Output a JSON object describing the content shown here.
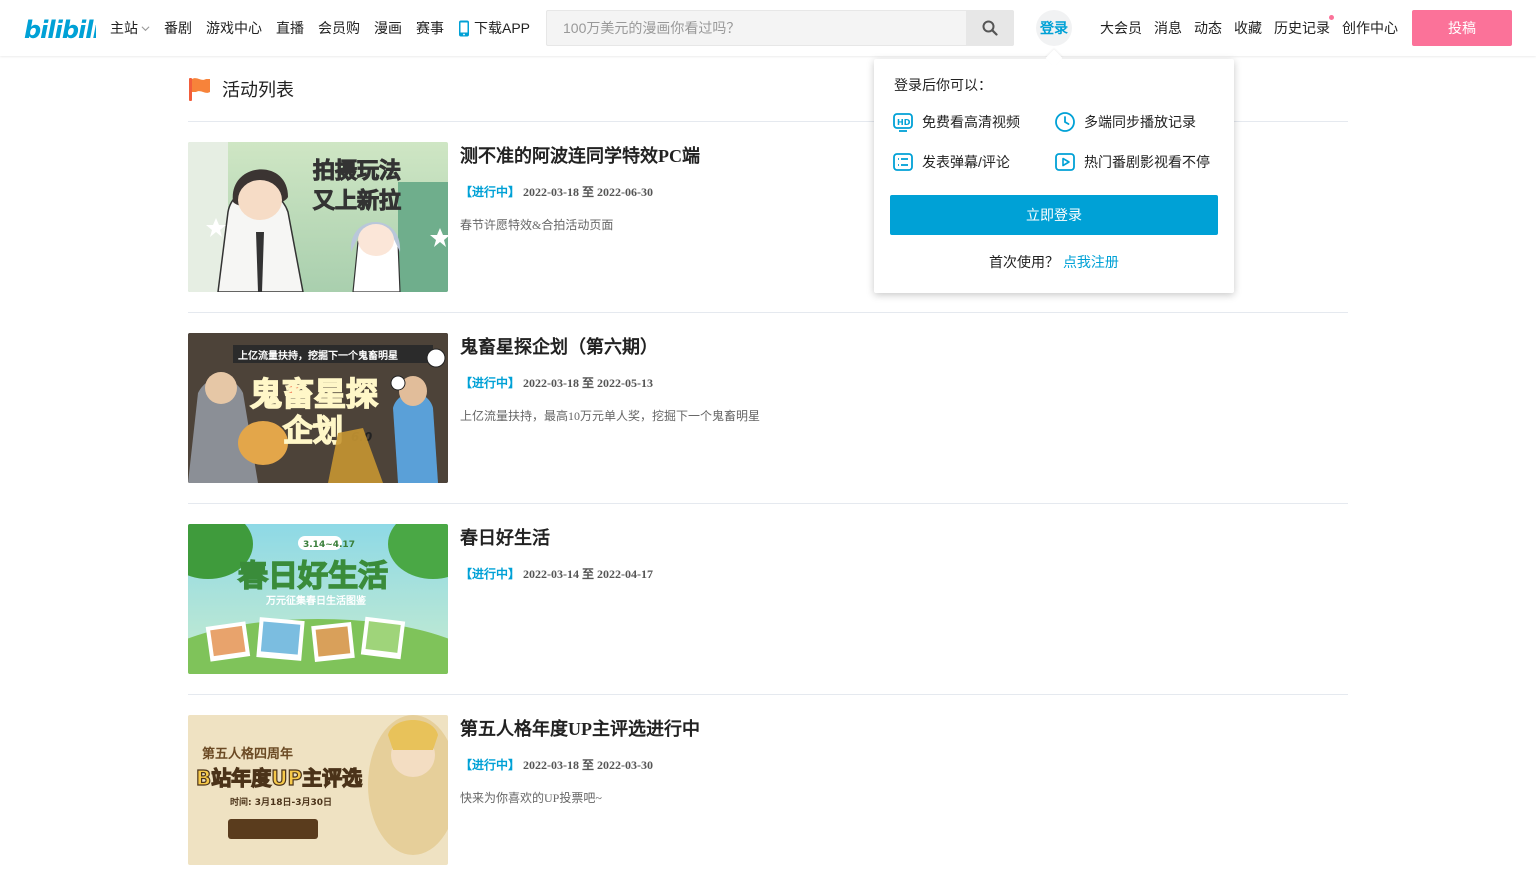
{
  "header": {
    "logo_text": "bilibili",
    "nav_left": [
      {
        "label": "主站",
        "has_dropdown": true
      },
      {
        "label": "番剧"
      },
      {
        "label": "游戏中心"
      },
      {
        "label": "直播"
      },
      {
        "label": "会员购"
      },
      {
        "label": "漫画"
      },
      {
        "label": "赛事"
      },
      {
        "label": "下载APP",
        "icon": "phone-icon"
      }
    ],
    "search": {
      "placeholder": "100万美元的漫画你看过吗？",
      "icon": "search-icon"
    },
    "login_label": "登录",
    "nav_right": [
      {
        "label": "大会员"
      },
      {
        "label": "消息"
      },
      {
        "label": "动态"
      },
      {
        "label": "收藏"
      },
      {
        "label": "历史记录",
        "has_dot": true
      },
      {
        "label": "创作中心"
      }
    ],
    "upload_label": "投稿",
    "colors": {
      "brand_blue": "#00a1d6",
      "brand_pink": "#fb7299"
    }
  },
  "main": {
    "title": "活动列表",
    "title_icon": "flag-icon",
    "activities": [
      {
        "title": "测不准的阿波连同学特效PC端",
        "status": "【进行中】",
        "start": "2022-03-18",
        "range_sep": "至",
        "end": "2022-06-30",
        "desc": "春节许愿特效&合拍活动页面",
        "thumb_text_1": "拍摄玩法",
        "thumb_text_2": "又上新拉"
      },
      {
        "title": "鬼畜星探企划（第六期）",
        "status": "【进行中】",
        "start": "2022-03-18",
        "range_sep": "至",
        "end": "2022-05-13",
        "desc": "上亿流量扶持，最高10万元单人奖，挖掘下一个鬼畜明星",
        "thumb_text_1": "上亿流量扶持，挖掘下一个鬼畜明星",
        "thumb_text_2": "鬼畜星探",
        "thumb_text_3": "企划",
        "thumb_text_4": "6.0"
      },
      {
        "title": "春日好生活",
        "status": "【进行中】",
        "start": "2022-03-14",
        "range_sep": "至",
        "end": "2022-04-17",
        "desc": "",
        "thumb_text_1": "3.14~4.17",
        "thumb_text_2": "春日好生活",
        "thumb_text_3": "万元征集春日生活图鉴"
      },
      {
        "title": "第五人格年度UP主评选进行中",
        "status": "【进行中】",
        "start": "2022-03-18",
        "range_sep": "至",
        "end": "2022-03-30",
        "desc": "快来为你喜欢的UP投票吧~",
        "thumb_text_1": "第五人格四周年",
        "thumb_text_2": "B站年度UP主评选",
        "thumb_text_3": "时间: 3月18日-3月30日"
      }
    ]
  },
  "login_popup": {
    "title": "登录后你可以：",
    "perks": [
      {
        "label": "免费看高清视频",
        "icon": "hd-icon"
      },
      {
        "label": "多端同步播放记录",
        "icon": "clock-icon"
      },
      {
        "label": "发表弹幕/评论",
        "icon": "list-icon"
      },
      {
        "label": "热门番剧影视看不停",
        "icon": "play-icon"
      }
    ],
    "login_button": "立即登录",
    "register_prompt": "首次使用？",
    "register_link": "点我注册"
  }
}
